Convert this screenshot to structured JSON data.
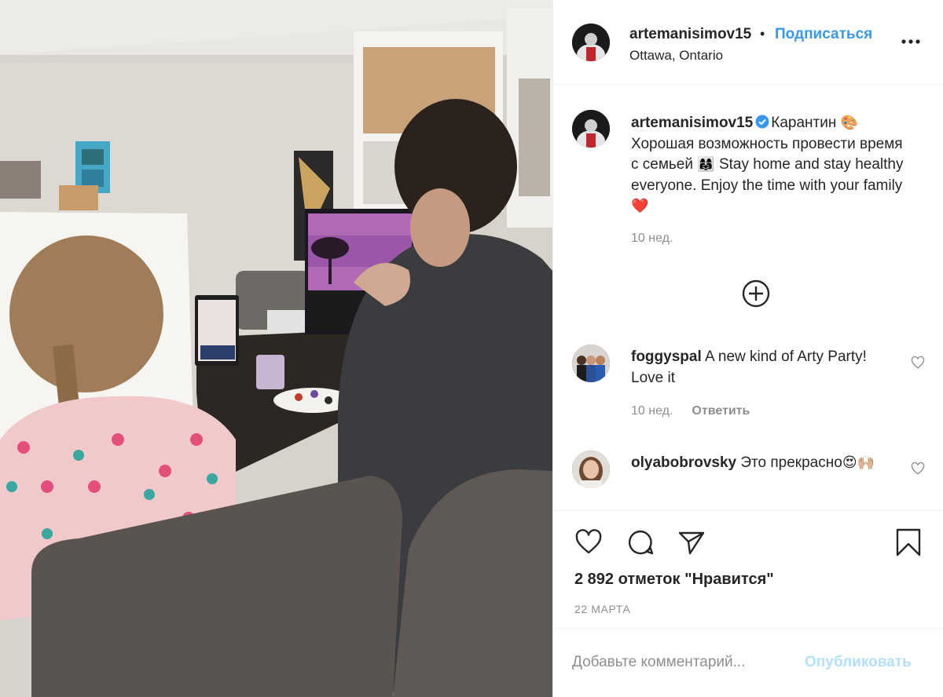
{
  "post": {
    "photo_alt": "",
    "header": {
      "username": "artemanisimov15",
      "separator": "•",
      "follow_label": "Подписаться",
      "location": "Ottawa, Ontario",
      "more_icon": "more-horizontal-icon"
    },
    "caption": {
      "username": "artemanisimov15",
      "verified_icon": "verified-badge-icon",
      "text_1": "Карантин ",
      "emoji_1": "🎨",
      "text_2": " Хорошая возможность провести время с семьей ",
      "emoji_2": "👩‍👩‍👧",
      "text_3": " Stay home and stay healthy everyone. Enjoy the time with your family ",
      "emoji_3": "❤️",
      "time": "10 нед."
    },
    "load_more_icon": "plus-circle-icon",
    "comments": [
      {
        "username": "foggyspal",
        "text": "A new kind of Arty Party! Love it",
        "time": "10 нед.",
        "reply_label": "Ответить"
      },
      {
        "username": "olyabobrovsky",
        "text": "Это прекрасно",
        "emoji": "😍🙌🏼"
      }
    ],
    "actions": {
      "like_icon": "heart-icon",
      "comment_icon": "comment-bubble-icon",
      "share_icon": "send-paper-plane-icon",
      "save_icon": "bookmark-icon"
    },
    "likes_text": "2 892 отметок \"Нравится\"",
    "date": "22 МАРТА",
    "add_comment": {
      "placeholder": "Добавьте комментарий...",
      "post_label": "Опубликовать"
    }
  },
  "colors": {
    "link_blue": "#3897f0",
    "post_disabled": "#b2dffc",
    "secondary_text": "#8e8e8e",
    "primary_text": "#262626",
    "verified_blue": "#3897f0"
  }
}
